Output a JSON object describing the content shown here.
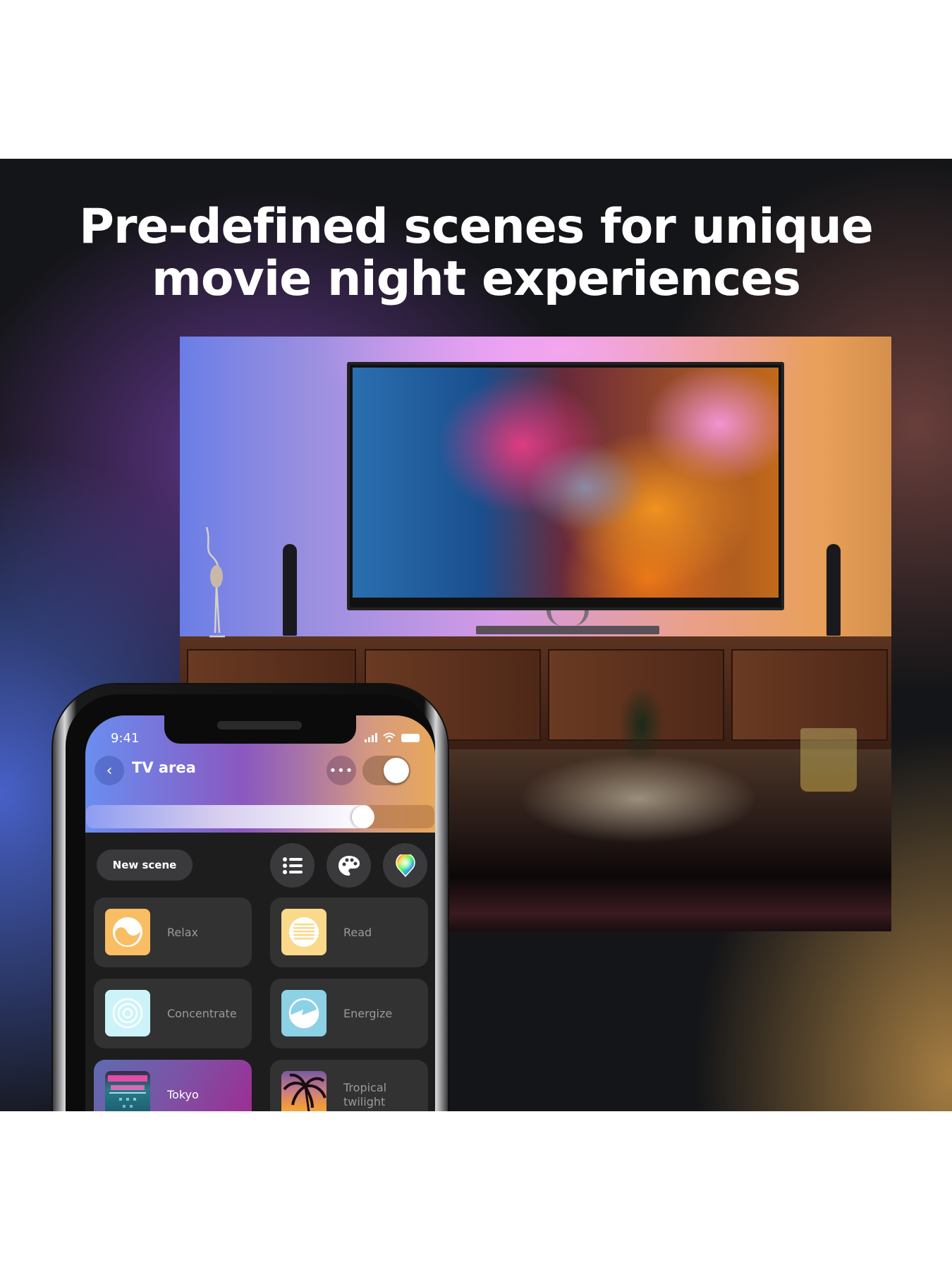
{
  "headline": {
    "line1": "Pre-defined scenes for unique",
    "line2": "movie night experiences"
  },
  "colors": {
    "background": "#ffffff",
    "band": "#141518",
    "app_panel": "#1d1d1d",
    "tile": "#323233",
    "button": "#3a3a3c",
    "tile_label": "#9a9a9a",
    "accent_blue": "#6a8ef0",
    "accent_purple": "#8a58c0",
    "accent_amber": "#e8a85a",
    "active_tile_magenta": "#a02a92"
  },
  "phone": {
    "status_bar": {
      "time": "9:41",
      "icons": [
        "signal-icon",
        "wifi-icon",
        "battery-icon"
      ]
    },
    "header": {
      "back_icon": "chevron-left-icon",
      "back_glyph": "‹",
      "title": "TV area",
      "more_icon": "more-horizontal-icon",
      "more_glyph": "•••",
      "power_toggle_on": true
    },
    "brightness": {
      "value_percent": 82
    },
    "toolbar": {
      "new_scene_label": "New scene",
      "icons": [
        "list-icon",
        "palette-icon",
        "color-picker-icon"
      ]
    },
    "scenes": [
      {
        "label": "Relax",
        "icon": "relax-icon",
        "color": "#f9bd63",
        "active": false
      },
      {
        "label": "Read",
        "icon": "read-icon",
        "color": "#fbd98a",
        "active": false
      },
      {
        "label": "Concentrate",
        "icon": "concentrate-icon",
        "color": "#cdf3fa",
        "active": false
      },
      {
        "label": "Energize",
        "icon": "energize-icon",
        "color": "#8dd1e6",
        "active": false
      },
      {
        "label": "Tokyo",
        "icon": "tokyo-thumbnail",
        "color": "#1f6f80",
        "active": true
      },
      {
        "label": "Tropical twilight",
        "icon": "tropical-twilight-thumbnail",
        "color": "#e08a3a",
        "active": false
      }
    ]
  }
}
